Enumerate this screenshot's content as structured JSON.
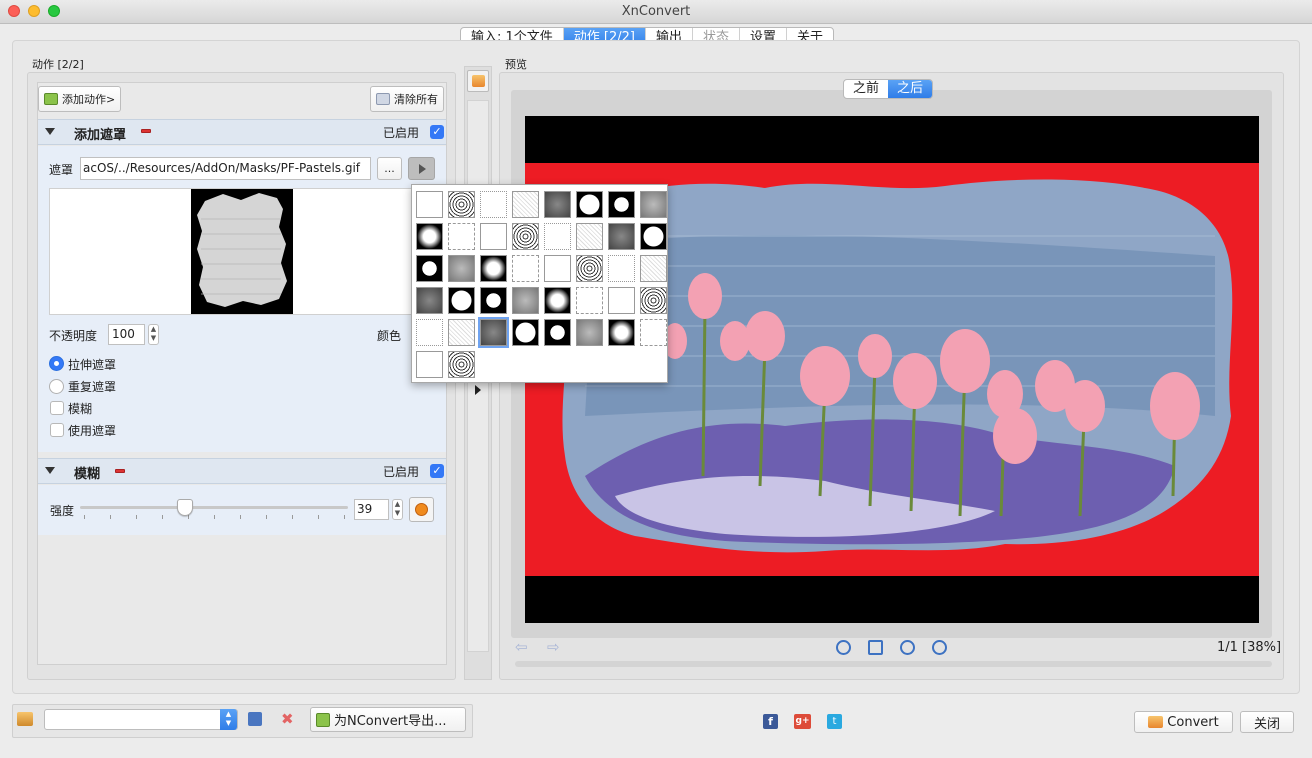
{
  "window": {
    "title": "XnConvert"
  },
  "tabs": [
    {
      "label": "输入: 1个文件",
      "state": "normal"
    },
    {
      "label": "动作 [2/2]",
      "state": "active"
    },
    {
      "label": "输出",
      "state": "normal"
    },
    {
      "label": "状态",
      "state": "disabled"
    },
    {
      "label": "设置",
      "state": "normal"
    },
    {
      "label": "关于",
      "state": "normal"
    }
  ],
  "actions_panel": {
    "title": "动作 [2/2]",
    "add_button": "添加动作>",
    "clear_button": "清除所有",
    "mask_section": {
      "title": "添加遮罩",
      "enabled_label": "已启用",
      "enabled": true,
      "mask_label": "遮罩",
      "mask_path": "acOS/../Resources/AddOn/Masks/PF-Pastels.gif",
      "browse_button": "...",
      "opacity_label": "不透明度",
      "opacity_value": "100",
      "color_label": "颜色",
      "options": [
        {
          "label": "拉伸遮罩",
          "type": "radio",
          "checked": true
        },
        {
          "label": "重复遮罩",
          "type": "radio",
          "checked": false
        },
        {
          "label": "模糊",
          "type": "checkbox",
          "checked": false
        },
        {
          "label": "使用遮罩",
          "type": "checkbox",
          "checked": false
        }
      ]
    },
    "blur_section": {
      "title": "模糊",
      "enabled_label": "已启用",
      "enabled": true,
      "strength_label": "强度",
      "strength_value": "39",
      "slider_fraction": 0.39
    }
  },
  "preview": {
    "title": "预览",
    "before_label": "之前",
    "after_label": "之后",
    "selected": "之后",
    "page_info": "1/1 [38%]"
  },
  "bottom_bar": {
    "export_button": "为NConvert导出...",
    "convert_button": "Convert",
    "close_button": "关闭"
  },
  "colors": {
    "accent": "#3478f6",
    "background": "#ed1c24"
  }
}
